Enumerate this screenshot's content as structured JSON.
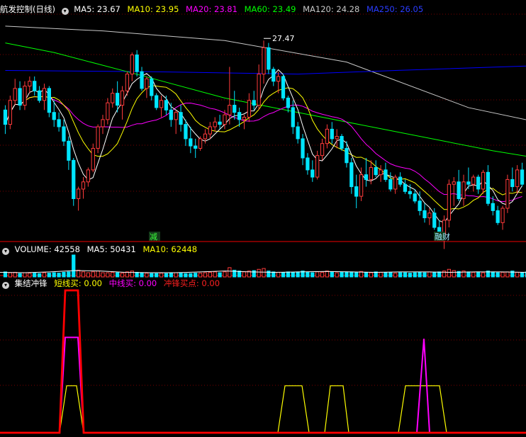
{
  "colors": {
    "background": "#000000",
    "grid": "#7a0000",
    "divider": "#a00000",
    "candle_up": "#ff3b3b",
    "candle_down": "#00e5ff",
    "ma5": "#ffffff",
    "ma10": "#ffff00",
    "ma20": "#ff00ff",
    "ma60": "#00ff00",
    "ma120": "#c8c8c8",
    "ma250": "#0000ff",
    "line_short": "#ffff00",
    "line_mid": "#ff00ff",
    "line_charge": "#ff0000"
  },
  "main_panel": {
    "title": "航发控制(日线)",
    "icon": "chevron-down-icon",
    "legend": [
      {
        "key": "ma5",
        "label": "MA5: 23.67"
      },
      {
        "key": "ma10",
        "label": "MA10: 23.95"
      },
      {
        "key": "ma20",
        "label": "MA20: 23.81"
      },
      {
        "key": "ma60",
        "label": "MA60: 23.49"
      },
      {
        "key": "ma120",
        "label": "MA120: 24.28"
      },
      {
        "key": "ma250",
        "label": "MA250: 26.05"
      }
    ],
    "high_marker": "27.47",
    "event_labels": [
      "减",
      "融财"
    ]
  },
  "volume_panel": {
    "icon": "chevron-down-icon",
    "legend": [
      {
        "key": "ma5",
        "label": "VOLUME: 42558"
      },
      {
        "key": "ma10",
        "label": "MA5: 50431"
      },
      {
        "key": "ma10b",
        "label": "MA10: 62448"
      }
    ]
  },
  "indicator_panel": {
    "icon": "chevron-down-icon",
    "name": "集结冲锋",
    "legend": [
      {
        "key": "line_short",
        "label": "短线买: 0.00"
      },
      {
        "key": "line_mid",
        "label": "中线买: 0.00"
      },
      {
        "key": "line_charge",
        "label": "冲锋买点: 0.00"
      }
    ]
  },
  "chart_data": {
    "type": "candlestick",
    "price_range": [
      19.2,
      28.6
    ],
    "high_marker_value": 27.47,
    "candles": [
      [
        24.6,
        24.8,
        23.6,
        24.0
      ],
      [
        24.0,
        25.2,
        23.8,
        25.0
      ],
      [
        25.0,
        25.9,
        24.8,
        25.5
      ],
      [
        25.5,
        25.8,
        24.6,
        24.8
      ],
      [
        24.8,
        25.8,
        24.6,
        25.6
      ],
      [
        25.6,
        26.0,
        25.3,
        25.8
      ],
      [
        25.8,
        26.0,
        25.2,
        25.4
      ],
      [
        25.4,
        25.6,
        24.9,
        25.0
      ],
      [
        25.0,
        25.7,
        24.6,
        25.5
      ],
      [
        25.5,
        25.6,
        24.3,
        24.5
      ],
      [
        24.5,
        25.0,
        23.9,
        24.2
      ],
      [
        24.2,
        24.5,
        23.7,
        23.9
      ],
      [
        23.9,
        24.2,
        23.1,
        23.3
      ],
      [
        23.3,
        23.5,
        22.1,
        22.5
      ],
      [
        22.5,
        22.6,
        20.6,
        20.9
      ],
      [
        20.9,
        21.4,
        20.4,
        21.3
      ],
      [
        21.3,
        21.8,
        20.9,
        21.6
      ],
      [
        21.6,
        22.2,
        21.4,
        22.1
      ],
      [
        22.1,
        23.2,
        22.0,
        23.0
      ],
      [
        23.0,
        24.0,
        22.8,
        23.9
      ],
      [
        23.9,
        24.4,
        23.6,
        24.2
      ],
      [
        24.2,
        25.1,
        24.0,
        24.9
      ],
      [
        24.9,
        25.5,
        24.7,
        25.3
      ],
      [
        25.3,
        25.8,
        24.5,
        24.8
      ],
      [
        24.8,
        25.6,
        24.2,
        25.4
      ],
      [
        25.4,
        26.2,
        25.2,
        26.1
      ],
      [
        26.1,
        27.0,
        25.8,
        26.9
      ],
      [
        26.9,
        27.1,
        26.0,
        26.2
      ],
      [
        26.2,
        26.4,
        25.4,
        25.5
      ],
      [
        25.5,
        26.0,
        25.1,
        25.9
      ],
      [
        25.9,
        26.0,
        25.0,
        25.2
      ],
      [
        25.2,
        25.3,
        24.6,
        24.7
      ],
      [
        24.7,
        25.2,
        24.3,
        25.0
      ],
      [
        25.0,
        25.2,
        24.4,
        24.6
      ],
      [
        24.6,
        24.9,
        23.9,
        24.2
      ],
      [
        24.2,
        24.6,
        23.6,
        24.5
      ],
      [
        24.5,
        24.8,
        23.7,
        24.0
      ],
      [
        24.0,
        24.2,
        23.1,
        23.4
      ],
      [
        23.4,
        23.9,
        22.8,
        23.1
      ],
      [
        23.1,
        23.4,
        22.6,
        23.0
      ],
      [
        23.0,
        23.5,
        22.9,
        23.4
      ],
      [
        23.4,
        23.8,
        23.2,
        23.6
      ],
      [
        23.6,
        24.1,
        23.4,
        23.9
      ],
      [
        23.9,
        24.3,
        23.7,
        24.1
      ],
      [
        24.1,
        24.4,
        23.8,
        24.0
      ],
      [
        24.0,
        24.6,
        23.8,
        24.4
      ],
      [
        24.4,
        26.4,
        24.0,
        24.8
      ],
      [
        24.8,
        25.4,
        24.2,
        24.5
      ],
      [
        24.5,
        24.7,
        23.9,
        24.2
      ],
      [
        24.2,
        24.4,
        23.8,
        24.3
      ],
      [
        24.3,
        25.3,
        24.1,
        25.0
      ],
      [
        25.0,
        25.4,
        24.6,
        24.8
      ],
      [
        24.8,
        26.5,
        24.6,
        26.1
      ],
      [
        26.1,
        27.5,
        25.7,
        27.2
      ],
      [
        27.2,
        27.4,
        26.1,
        26.3
      ],
      [
        26.3,
        26.4,
        25.6,
        25.8
      ],
      [
        25.8,
        26.2,
        25.3,
        26.0
      ],
      [
        26.0,
        26.1,
        25.0,
        25.1
      ],
      [
        25.1,
        25.2,
        24.5,
        24.7
      ],
      [
        24.7,
        25.0,
        23.6,
        23.9
      ],
      [
        23.9,
        24.1,
        23.2,
        23.4
      ],
      [
        23.4,
        23.6,
        22.3,
        22.6
      ],
      [
        22.6,
        22.8,
        21.9,
        22.1
      ],
      [
        22.1,
        22.5,
        21.6,
        21.8
      ],
      [
        21.8,
        22.9,
        21.7,
        22.7
      ],
      [
        22.7,
        23.4,
        22.5,
        23.2
      ],
      [
        23.2,
        24.0,
        23.0,
        23.8
      ],
      [
        23.8,
        24.1,
        23.2,
        23.4
      ],
      [
        23.4,
        23.8,
        23.0,
        23.5
      ],
      [
        23.5,
        23.6,
        22.9,
        23.0
      ],
      [
        23.0,
        23.3,
        22.2,
        22.4
      ],
      [
        22.4,
        22.6,
        21.1,
        21.4
      ],
      [
        21.4,
        21.9,
        20.5,
        21.0
      ],
      [
        21.0,
        22.2,
        20.8,
        21.9
      ],
      [
        21.9,
        22.6,
        21.4,
        21.7
      ],
      [
        21.7,
        22.5,
        21.5,
        22.2
      ],
      [
        22.2,
        22.5,
        21.8,
        21.9
      ],
      [
        21.9,
        22.3,
        21.6,
        22.1
      ],
      [
        22.1,
        22.4,
        21.6,
        21.7
      ],
      [
        21.7,
        22.0,
        21.2,
        21.3
      ],
      [
        21.3,
        21.9,
        21.1,
        21.8
      ],
      [
        21.8,
        22.0,
        21.4,
        21.5
      ],
      [
        21.5,
        21.7,
        21.1,
        21.2
      ],
      [
        21.2,
        21.5,
        20.9,
        21.1
      ],
      [
        21.1,
        21.3,
        20.7,
        20.8
      ],
      [
        20.8,
        21.2,
        20.2,
        20.4
      ],
      [
        20.4,
        20.7,
        19.9,
        20.1
      ],
      [
        20.1,
        20.5,
        19.8,
        20.3
      ],
      [
        20.3,
        20.5,
        19.6,
        19.7
      ],
      [
        19.7,
        20.0,
        19.2,
        19.4
      ],
      [
        19.4,
        20.2,
        18.8,
        20.0
      ],
      [
        20.0,
        21.7,
        19.7,
        21.5
      ],
      [
        21.5,
        21.8,
        20.6,
        21.6
      ],
      [
        21.6,
        22.1,
        20.8,
        20.9
      ],
      [
        20.9,
        21.9,
        20.6,
        21.6
      ],
      [
        21.6,
        22.2,
        21.3,
        21.5
      ],
      [
        21.5,
        21.9,
        21.2,
        21.8
      ],
      [
        21.8,
        21.9,
        21.1,
        21.3
      ],
      [
        21.3,
        22.1,
        21.1,
        22.0
      ],
      [
        22.0,
        22.3,
        20.6,
        20.7
      ],
      [
        20.7,
        21.0,
        20.2,
        20.4
      ],
      [
        20.4,
        20.6,
        19.8,
        19.9
      ],
      [
        19.9,
        20.6,
        19.6,
        20.5
      ],
      [
        20.5,
        21.9,
        20.3,
        21.7
      ],
      [
        21.7,
        22.2,
        21.2,
        21.4
      ],
      [
        21.4,
        22.3,
        21.1,
        22.1
      ],
      [
        22.1,
        22.4,
        21.4,
        21.5
      ]
    ],
    "ma_lines": {
      "ma120": [
        [
          0,
          28.1
        ],
        [
          20,
          27.9
        ],
        [
          45,
          27.5
        ],
        [
          70,
          26.6
        ],
        [
          95,
          24.7
        ],
        [
          109,
          24.1
        ]
      ],
      "ma250": [
        [
          0,
          26.25
        ],
        [
          30,
          26.2
        ],
        [
          60,
          26.1
        ],
        [
          80,
          26.25
        ],
        [
          109,
          26.45
        ]
      ],
      "ma60": [
        [
          0,
          27.4
        ],
        [
          10,
          27.0
        ],
        [
          25,
          26.2
        ],
        [
          45,
          25.1
        ],
        [
          60,
          24.5
        ],
        [
          75,
          23.9
        ],
        [
          90,
          23.3
        ],
        [
          100,
          22.9
        ],
        [
          109,
          22.6
        ]
      ]
    },
    "volume": [
      0.6,
      0.5,
      0.55,
      0.4,
      0.5,
      0.45,
      0.45,
      0.4,
      0.5,
      0.45,
      0.5,
      0.45,
      0.55,
      0.6,
      2.6,
      0.8,
      0.6,
      0.5,
      0.6,
      0.7,
      0.5,
      0.5,
      0.55,
      0.5,
      0.45,
      0.6,
      0.7,
      0.55,
      0.5,
      0.45,
      0.4,
      0.4,
      0.45,
      0.4,
      0.45,
      0.5,
      0.45,
      0.4,
      0.4,
      0.45,
      0.45,
      0.5,
      0.55,
      0.6,
      0.5,
      0.6,
      1.1,
      0.8,
      0.7,
      0.6,
      0.7,
      0.75,
      0.9,
      1.0,
      0.7,
      0.6,
      0.55,
      0.5,
      0.6,
      0.55,
      0.6,
      0.7,
      0.55,
      0.5,
      0.6,
      0.55,
      0.7,
      0.6,
      0.5,
      0.55,
      0.6,
      0.6,
      0.5,
      0.65,
      0.55,
      0.5,
      0.6,
      0.55,
      0.5,
      0.5,
      0.45,
      0.5,
      0.5,
      0.45,
      0.5,
      0.55,
      0.5,
      0.6,
      0.55,
      0.6,
      0.7,
      0.9,
      0.75,
      0.65,
      0.7,
      0.6,
      0.55,
      0.6,
      0.5,
      0.7,
      0.6,
      0.5,
      0.55,
      0.6,
      0.7,
      0.55,
      0.5,
      0.6,
      0.55,
      0.5
    ],
    "volume_ma": [
      0.55,
      0.5,
      0.6,
      0.75,
      0.7,
      0.55,
      0.5,
      0.5,
      0.6,
      0.7,
      0.6,
      0.55,
      0.6,
      0.65,
      0.6,
      0.55,
      0.6,
      0.6,
      0.55,
      0.6,
      0.6,
      0.55
    ],
    "signals": {
      "x_range": [
        0,
        742
      ],
      "y_range": [
        0,
        100
      ],
      "line_charge": [
        [
          0,
          0
        ],
        [
          84,
          0
        ],
        [
          92,
          100
        ],
        [
          110,
          100
        ],
        [
          118,
          0
        ],
        [
          742,
          0
        ]
      ],
      "line_mid": [
        [
          0,
          0
        ],
        [
          84,
          0
        ],
        [
          92,
          67
        ],
        [
          110,
          67
        ],
        [
          118,
          0
        ],
        [
          588,
          0
        ],
        [
          598,
          66
        ],
        [
          606,
          0
        ],
        [
          742,
          0
        ]
      ],
      "line_short": [
        [
          0,
          0
        ],
        [
          84,
          0
        ],
        [
          94,
          33
        ],
        [
          108,
          33
        ],
        [
          118,
          0
        ],
        [
          392,
          0
        ],
        [
          402,
          33
        ],
        [
          426,
          33
        ],
        [
          436,
          0
        ],
        [
          458,
          0
        ],
        [
          466,
          33
        ],
        [
          484,
          33
        ],
        [
          492,
          0
        ],
        [
          562,
          0
        ],
        [
          572,
          33
        ],
        [
          620,
          33
        ],
        [
          630,
          0
        ],
        [
          742,
          0
        ]
      ]
    }
  }
}
